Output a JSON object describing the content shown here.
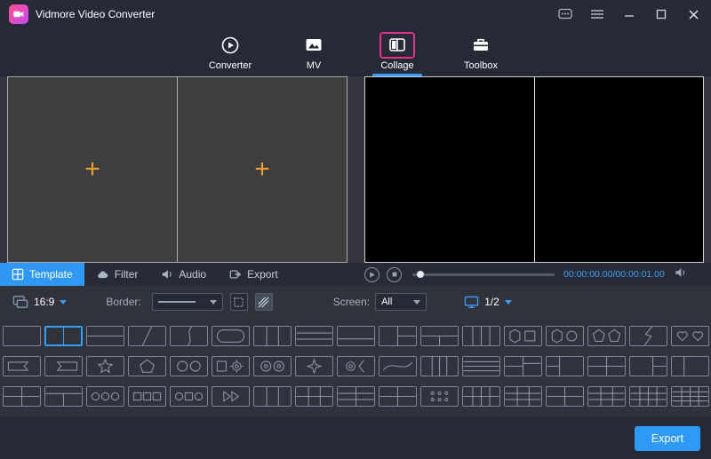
{
  "titlebar": {
    "title": "Vidmore Video Converter",
    "window_icons": [
      "feedback-icon",
      "menu-icon",
      "minimize-icon",
      "maximize-icon",
      "close-icon"
    ]
  },
  "nav": {
    "tabs": [
      {
        "label": "Converter",
        "icon": "play-circle-icon",
        "active": false
      },
      {
        "label": "MV",
        "icon": "picture-icon",
        "active": false
      },
      {
        "label": "Collage",
        "icon": "collage-grid-icon",
        "active": true
      },
      {
        "label": "Toolbox",
        "icon": "toolbox-icon",
        "active": false
      }
    ]
  },
  "editor": {
    "slots": [
      {
        "icon": "add-plus-icon"
      },
      {
        "icon": "add-plus-icon"
      }
    ]
  },
  "left_tabs": {
    "items": [
      {
        "label": "Template",
        "icon": "template-grid-icon",
        "active": true
      },
      {
        "label": "Filter",
        "icon": "cloud-icon",
        "active": false
      },
      {
        "label": "Audio",
        "icon": "speaker-icon",
        "active": false
      },
      {
        "label": "Export",
        "icon": "export-arrow-icon",
        "active": false
      }
    ]
  },
  "player": {
    "time": "00:00:00.00/00:00:01.00",
    "icons": [
      "play-icon",
      "stop-icon",
      "seek-slider",
      "volume-icon"
    ]
  },
  "toolbar": {
    "aspect_ratio": "16:9",
    "border_label": "Border:",
    "screen_label": "Screen:",
    "screen_value": "All",
    "page": "1/2"
  },
  "templates": {
    "selected": [
      0,
      1
    ],
    "rows": [
      [
        "blank",
        "split-v2",
        "split-h2",
        "split-diagonal",
        "split-curve",
        "inset-rounded",
        "split-v3",
        "split-h3",
        "split-h2-low",
        "left-large-right-split",
        "top-large-bottom-split",
        "split-v4",
        "hexagon-square",
        "hexagon-circle",
        "pentagon-pair",
        "lightning-split",
        "hearts-pair"
      ],
      [
        "banner-left",
        "banner-right",
        "star",
        "pentagon",
        "circles-pair",
        "gear-square",
        "circles-pair-b",
        "sparkle",
        "gear-bracket",
        "wave-swoosh",
        "stripes-vertical",
        "stripes-horizontal",
        "grid-2x2-split",
        "left-v2-right-large",
        "cross-2x2",
        "left-large-right-h2",
        "grid-2x1"
      ],
      [
        "grid-2x2",
        "top-h-bottom-v",
        "circles-trio",
        "squares-trio",
        "circle-square-circle",
        "fast-forward",
        "split-v3-b",
        "grid-3x2",
        "grid-2x3",
        "grid-2x2-c",
        "dots-grid",
        "grid-4x2",
        "grid-3x3",
        "grid-2x2-d",
        "grid-3x3-b",
        "grid-4x3",
        "grid-4x4"
      ]
    ]
  },
  "footer": {
    "export_label": "Export"
  },
  "colors": {
    "accent_blue": "#2F9AF3",
    "highlight_pink": "#E5318A",
    "plus_orange": "#F0A030",
    "titlebar_bg": "#262A36",
    "panel_bg": "#30323C"
  }
}
